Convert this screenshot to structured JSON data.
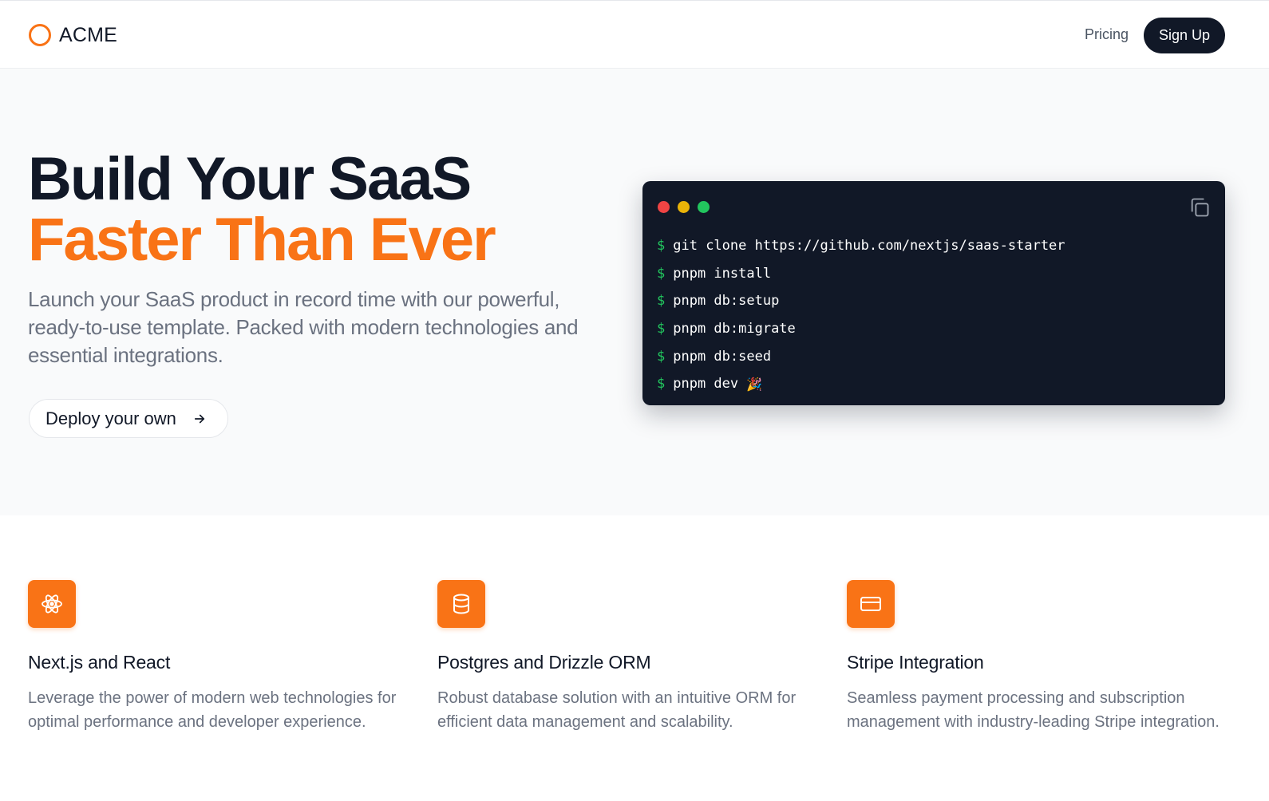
{
  "header": {
    "logo_text": "ACME",
    "pricing_label": "Pricing",
    "signup_label": "Sign Up"
  },
  "hero": {
    "title_line1": "Build Your SaaS",
    "title_line2": "Faster Than Ever",
    "subtitle": "Launch your SaaS product in record time with our powerful, ready-to-use template. Packed with modern technologies and essential integrations.",
    "cta_label": "Deploy your own",
    "cta_icon": "arrow-right-icon"
  },
  "terminal": {
    "dot_colors": [
      "#ef4444",
      "#eab308",
      "#22c55e"
    ],
    "prompt": "$",
    "commands": [
      "git clone https://github.com/nextjs/saas-starter",
      "pnpm install",
      "pnpm db:setup",
      "pnpm db:migrate",
      "pnpm db:seed",
      "pnpm dev"
    ],
    "last_emoji": "🎉",
    "copy_icon": "copy-icon"
  },
  "features": [
    {
      "icon": "atom-icon",
      "title": "Next.js and React",
      "description": "Leverage the power of modern web technologies for optimal performance and developer experience."
    },
    {
      "icon": "database-icon",
      "title": "Postgres and Drizzle ORM",
      "description": "Robust database solution with an intuitive ORM for efficient data management and scalability."
    },
    {
      "icon": "credit-card-icon",
      "title": "Stripe Integration",
      "description": "Seamless payment processing and subscription management with industry-leading Stripe integration."
    }
  ],
  "colors": {
    "accent": "#f97316",
    "dark": "#111827",
    "muted": "#6b7280"
  }
}
